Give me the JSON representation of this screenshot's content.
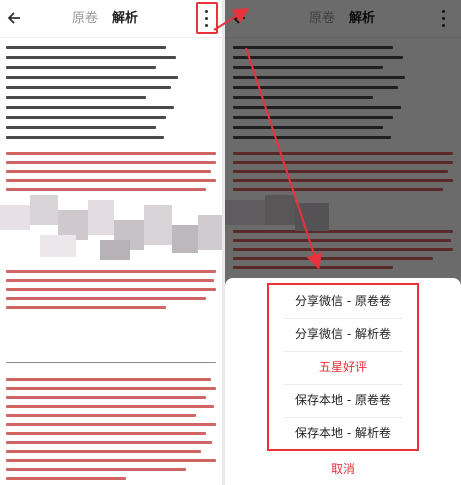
{
  "left": {
    "tabs": [
      {
        "label": "原卷",
        "active": false
      },
      {
        "label": "解析",
        "active": true
      }
    ]
  },
  "right": {
    "tabs": [
      {
        "label": "原卷",
        "active": false
      },
      {
        "label": "解析",
        "active": true
      }
    ],
    "menu": {
      "items": [
        {
          "label": "分享微信 - 原卷卷",
          "emphasis": false
        },
        {
          "label": "分享微信 - 解析卷",
          "emphasis": false
        },
        {
          "label": "五星好评",
          "emphasis": true
        },
        {
          "label": "保存本地 - 原卷卷",
          "emphasis": false
        },
        {
          "label": "保存本地 - 解析卷",
          "emphasis": false
        }
      ],
      "cancel": "取消"
    }
  },
  "colors": {
    "accent": "#e8323c",
    "doc_red": "#c94a4a"
  },
  "icons": [
    "back-arrow-icon",
    "more-vertical-icon"
  ]
}
